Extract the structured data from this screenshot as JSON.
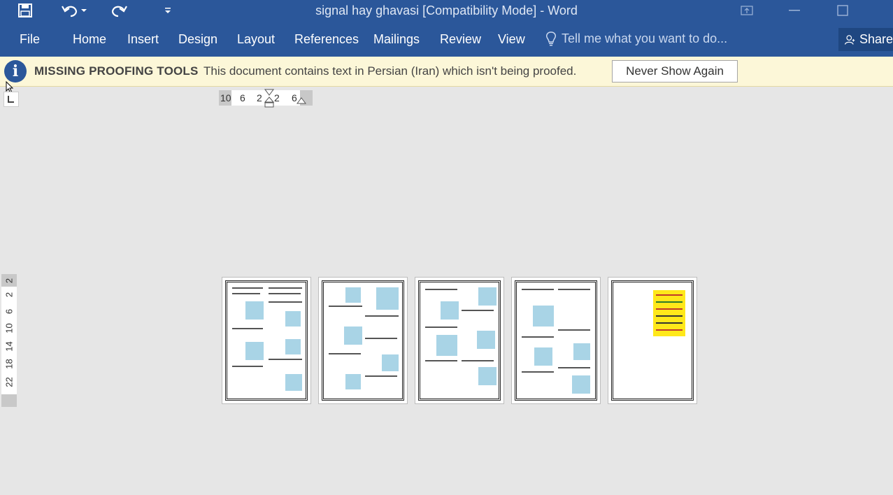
{
  "window": {
    "title": "signal hay ghavasi [Compatibility Mode] - Word"
  },
  "quick_access": {
    "save_icon": "save-icon",
    "undo_icon": "undo-icon",
    "redo_icon": "redo-icon",
    "customize_icon": "customize-qat-icon"
  },
  "ribbon": {
    "tabs": [
      "File",
      "Home",
      "Insert",
      "Design",
      "Layout",
      "References",
      "Mailings",
      "Review",
      "View"
    ],
    "tell_me": "Tell me what you want to do...",
    "share": "Share"
  },
  "message_bar": {
    "heading": "MISSING PROOFING TOOLS",
    "text": "This document contains text in Persian (Iran) which isn't being proofed.",
    "button": "Never Show Again"
  },
  "horizontal_ruler": {
    "numbers": [
      "10",
      "6",
      "2",
      "2",
      "6"
    ]
  },
  "vertical_ruler": {
    "numbers": [
      "2",
      "2",
      "6",
      "10",
      "14",
      "18",
      "22"
    ]
  },
  "colors": {
    "brand": "#2b579a",
    "message_bar": "#fcf7d8",
    "canvas": "#e6e6e6"
  },
  "document": {
    "page_count_shown": 5
  }
}
